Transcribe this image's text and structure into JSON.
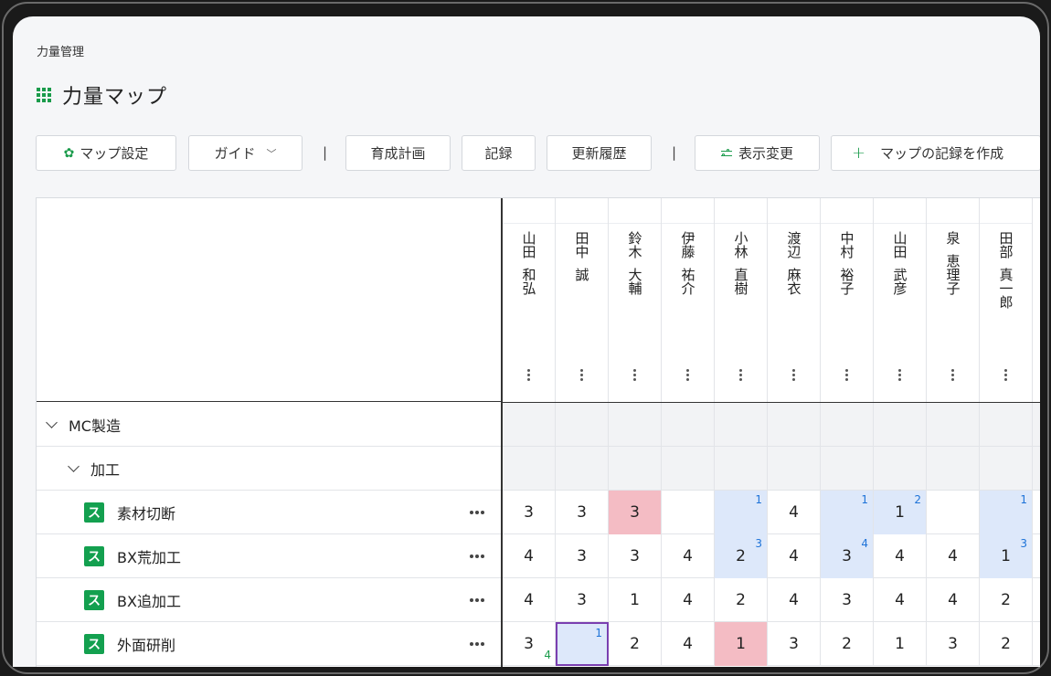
{
  "breadcrumb": "力量管理",
  "page_title": "力量マップ",
  "toolbar": {
    "map_settings": "マップ設定",
    "guide": "ガイド",
    "separator": "|",
    "training_plan": "育成計画",
    "record": "記録",
    "update_history": "更新履歴",
    "display_change": "表示変更",
    "create_map_record": "マップの記録を作成"
  },
  "members": [
    {
      "family": "山田",
      "given": "和弘"
    },
    {
      "family": "田中",
      "given": "誠"
    },
    {
      "family": "鈴木",
      "given": "大輔"
    },
    {
      "family": "伊藤",
      "given": "祐介"
    },
    {
      "family": "小林",
      "given": "直樹"
    },
    {
      "family": "渡辺",
      "given": "麻衣"
    },
    {
      "family": "中村",
      "given": "裕子"
    },
    {
      "family": "山田",
      "given": "武彦"
    },
    {
      "family": "泉",
      "given": "恵理子"
    },
    {
      "family": "田部",
      "given": "真一郎"
    }
  ],
  "groups": {
    "department": "MC製造",
    "section": "加工"
  },
  "skill_badge": "ス",
  "skills": [
    {
      "name": "素材切断",
      "cells": [
        {
          "v": "3"
        },
        {
          "v": "3"
        },
        {
          "v": "3",
          "bg": "pink"
        },
        {
          "v": ""
        },
        {
          "v": "",
          "sup": "1",
          "bg": "blue"
        },
        {
          "v": "4"
        },
        {
          "v": "",
          "sup": "1",
          "bg": "blue"
        },
        {
          "v": "1",
          "sup": "2",
          "bg": "blue"
        },
        {
          "v": ""
        },
        {
          "v": "",
          "sup": "1",
          "bg": "blue"
        }
      ]
    },
    {
      "name": "BX荒加工",
      "cells": [
        {
          "v": "4"
        },
        {
          "v": "3"
        },
        {
          "v": "3"
        },
        {
          "v": "4"
        },
        {
          "v": "2",
          "sup": "3",
          "bg": "blue"
        },
        {
          "v": "4"
        },
        {
          "v": "3",
          "sup": "4",
          "bg": "blue"
        },
        {
          "v": "4"
        },
        {
          "v": "4"
        },
        {
          "v": "1",
          "sup": "3",
          "bg": "blue"
        }
      ]
    },
    {
      "name": "BX追加工",
      "cells": [
        {
          "v": "4"
        },
        {
          "v": "3"
        },
        {
          "v": "1"
        },
        {
          "v": "4"
        },
        {
          "v": "2"
        },
        {
          "v": "4"
        },
        {
          "v": "3"
        },
        {
          "v": "4"
        },
        {
          "v": "4"
        },
        {
          "v": "2"
        }
      ]
    },
    {
      "name": "外面研削",
      "cells": [
        {
          "v": "3",
          "sub": "4"
        },
        {
          "v": "",
          "sup": "1",
          "bg": "blue",
          "selected": true
        },
        {
          "v": "2"
        },
        {
          "v": "4"
        },
        {
          "v": "1",
          "bg": "pink"
        },
        {
          "v": "3"
        },
        {
          "v": "2"
        },
        {
          "v": "1"
        },
        {
          "v": "3"
        },
        {
          "v": "2"
        }
      ]
    }
  ],
  "colors": {
    "accent": "#1a9b4b",
    "badge": "#13a04f",
    "target_blue": "#dde8fa",
    "alert_pink": "#f4bcc4",
    "superscript": "#1e73d8",
    "selection": "#7a3fb0"
  }
}
